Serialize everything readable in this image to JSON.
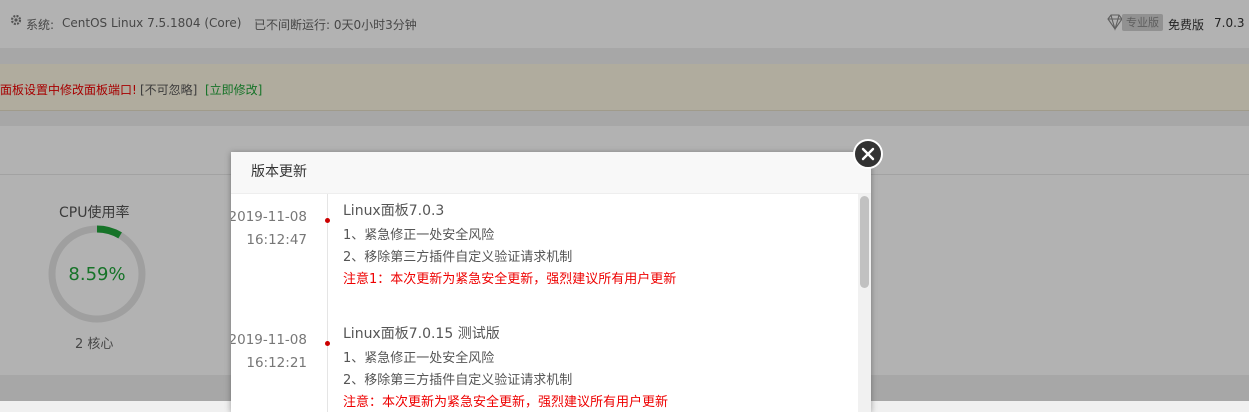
{
  "topbar": {
    "system_label": "系统:",
    "system_value": "CentOS Linux 7.5.1804 (Core)",
    "uptime": "已不间断运行: 0天0小时3分钟",
    "pro_badge": "专业版",
    "free_label": "免费版",
    "version": "7.0.3"
  },
  "warning": {
    "message": "面板设置中修改面板端口!",
    "ignore_label": "[不可忽略]",
    "fix_label": "[立即修改]"
  },
  "cpu": {
    "title": "CPU使用率",
    "value": "8.59%",
    "usage_percent": 8.59,
    "cores": "2 核心",
    "accent_color": "#20a53a"
  },
  "modal": {
    "title": "版本更新",
    "entries": [
      {
        "date": "2019-11-08",
        "time": "16:12:47",
        "title": "Linux面板7.0.3",
        "lines": [
          "1、紧急修正一处安全风险",
          "2、移除第三方插件自定义验证请求机制"
        ],
        "note": "注意1：本次更新为紧急安全更新，强烈建议所有用户更新"
      },
      {
        "date": "2019-11-08",
        "time": "16:12:21",
        "title": "Linux面板7.0.15 测试版",
        "lines": [
          "1、紧急修正一处安全风险",
          "2、移除第三方插件自定义验证请求机制"
        ],
        "note": "注意：本次更新为紧急安全更新，强烈建议所有用户更新"
      }
    ]
  }
}
